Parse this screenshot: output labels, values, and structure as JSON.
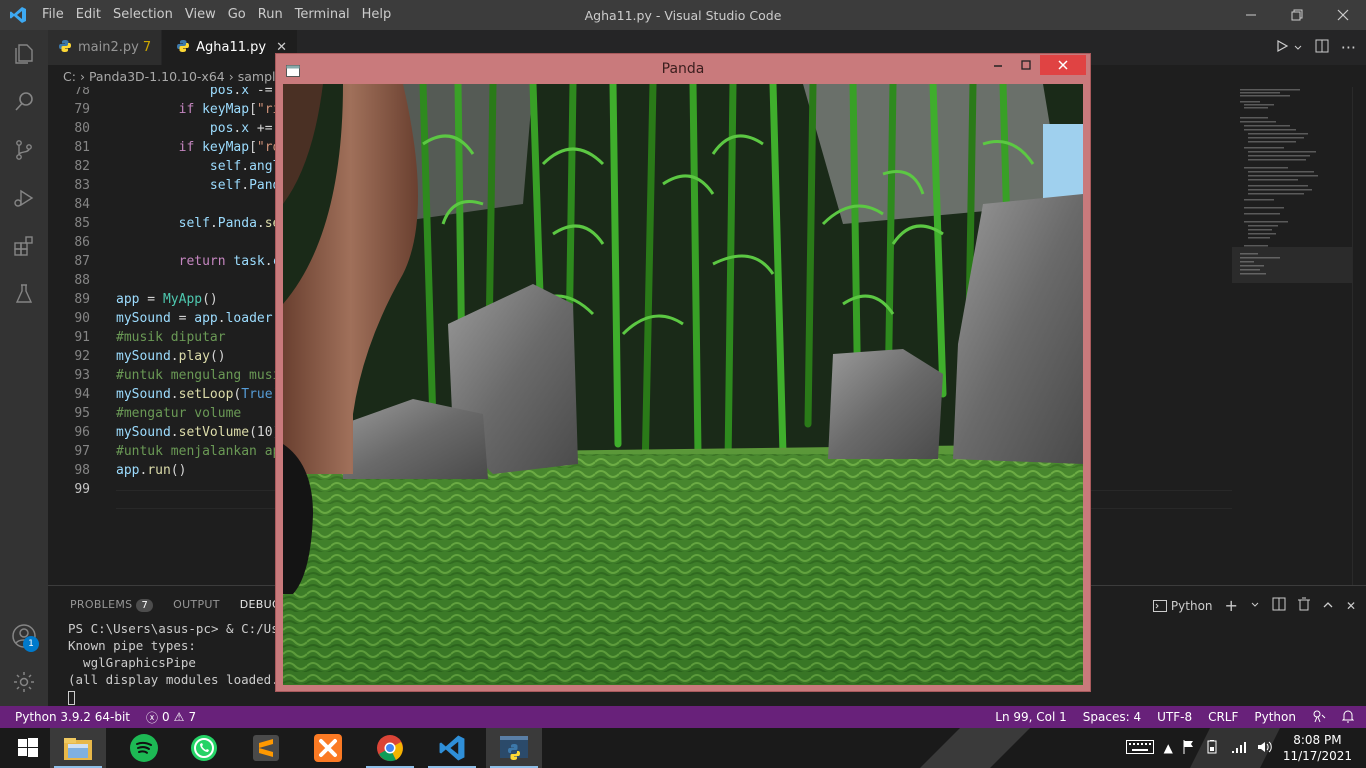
{
  "titlebar": {
    "menu": [
      "File",
      "Edit",
      "Selection",
      "View",
      "Go",
      "Run",
      "Terminal",
      "Help"
    ],
    "title": "Agha11.py - Visual Studio Code"
  },
  "tabs": [
    {
      "label": "main2.py",
      "warn": "7"
    },
    {
      "label": "Agha11.py"
    }
  ],
  "breadcrumb": [
    "C:",
    "Panda3D-1.10.10-x64",
    "samples"
  ],
  "activity": {
    "account_badge": "1"
  },
  "code_lines": [
    {
      "n": "78",
      "indent": "            ",
      "parts": [
        [
          "var",
          "pos"
        ],
        [
          "p",
          "."
        ],
        [
          "var",
          "x"
        ],
        [
          "p",
          " -="
        ]
      ]
    },
    {
      "n": "79",
      "indent": "        ",
      "parts": [
        [
          "kw",
          "if "
        ],
        [
          "var",
          "keyMap"
        ],
        [
          "p",
          "["
        ],
        [
          "str",
          "\"ri"
        ]
      ]
    },
    {
      "n": "80",
      "indent": "            ",
      "parts": [
        [
          "var",
          "pos"
        ],
        [
          "p",
          "."
        ],
        [
          "var",
          "x"
        ],
        [
          "p",
          " +="
        ]
      ]
    },
    {
      "n": "81",
      "indent": "        ",
      "parts": [
        [
          "kw",
          "if "
        ],
        [
          "var",
          "keyMap"
        ],
        [
          "p",
          "["
        ],
        [
          "str",
          "\"ro"
        ]
      ]
    },
    {
      "n": "82",
      "indent": "            ",
      "parts": [
        [
          "var",
          "self"
        ],
        [
          "p",
          "."
        ],
        [
          "var",
          "angl"
        ]
      ]
    },
    {
      "n": "83",
      "indent": "            ",
      "parts": [
        [
          "var",
          "self"
        ],
        [
          "p",
          "."
        ],
        [
          "var",
          "Pand"
        ]
      ]
    },
    {
      "n": "84",
      "indent": "",
      "parts": []
    },
    {
      "n": "85",
      "indent": "        ",
      "parts": [
        [
          "var",
          "self"
        ],
        [
          "p",
          "."
        ],
        [
          "var",
          "Panda"
        ],
        [
          "p",
          "."
        ],
        [
          "fn",
          "se"
        ]
      ]
    },
    {
      "n": "86",
      "indent": "",
      "parts": []
    },
    {
      "n": "87",
      "indent": "        ",
      "parts": [
        [
          "kw",
          "return "
        ],
        [
          "var",
          "task"
        ],
        [
          "p",
          "."
        ],
        [
          "var",
          "c"
        ]
      ]
    },
    {
      "n": "88",
      "indent": "",
      "parts": []
    },
    {
      "n": "89",
      "indent": "",
      "parts": [
        [
          "var",
          "app"
        ],
        [
          "p",
          " = "
        ],
        [
          "cls",
          "MyApp"
        ],
        [
          "p",
          "()"
        ]
      ]
    },
    {
      "n": "90",
      "indent": "",
      "parts": [
        [
          "var",
          "mySound"
        ],
        [
          "p",
          " = "
        ],
        [
          "var",
          "app"
        ],
        [
          "p",
          "."
        ],
        [
          "var",
          "loader"
        ],
        [
          "p",
          "."
        ]
      ]
    },
    {
      "n": "91",
      "indent": "",
      "parts": [
        [
          "cm",
          "#musik diputar"
        ]
      ]
    },
    {
      "n": "92",
      "indent": "",
      "parts": [
        [
          "var",
          "mySound"
        ],
        [
          "p",
          "."
        ],
        [
          "fn",
          "play"
        ],
        [
          "p",
          "()"
        ]
      ]
    },
    {
      "n": "93",
      "indent": "",
      "parts": [
        [
          "cm",
          "#untuk mengulang musi"
        ]
      ]
    },
    {
      "n": "94",
      "indent": "",
      "parts": [
        [
          "var",
          "mySound"
        ],
        [
          "p",
          "."
        ],
        [
          "fn",
          "setLoop"
        ],
        [
          "p",
          "("
        ],
        [
          "bool",
          "True"
        ],
        [
          "p",
          ")"
        ]
      ]
    },
    {
      "n": "95",
      "indent": "",
      "parts": [
        [
          "cm",
          "#mengatur volume"
        ]
      ]
    },
    {
      "n": "96",
      "indent": "",
      "parts": [
        [
          "var",
          "mySound"
        ],
        [
          "p",
          "."
        ],
        [
          "fn",
          "setVolume"
        ],
        [
          "p",
          "(10)"
        ]
      ]
    },
    {
      "n": "97",
      "indent": "",
      "parts": [
        [
          "cm",
          "#untuk menjalankan ap"
        ]
      ]
    },
    {
      "n": "98",
      "indent": "",
      "parts": [
        [
          "var",
          "app"
        ],
        [
          "p",
          "."
        ],
        [
          "fn",
          "run"
        ],
        [
          "p",
          "()"
        ]
      ]
    },
    {
      "n": "99",
      "indent": "",
      "parts": []
    }
  ],
  "panel": {
    "tabs": [
      "PROBLEMS",
      "OUTPUT",
      "DEBUG"
    ],
    "problems_count": "7",
    "shell": "Python",
    "terminal_lines": [
      "PS C:\\Users\\asus-pc> & C:/User",
      "Known pipe types:",
      "  wglGraphicsPipe",
      "(all display modules loaded.)"
    ]
  },
  "status": {
    "python": "Python 3.9.2 64-bit",
    "errors": "0",
    "warnings": "7",
    "position": "Ln 99, Col 1",
    "spaces": "Spaces: 4",
    "encoding": "UTF-8",
    "eol": "CRLF",
    "language": "Python"
  },
  "panda_window": {
    "title": "Panda"
  },
  "taskbar": {
    "time": "8:08 PM",
    "date": "11/17/2021"
  }
}
